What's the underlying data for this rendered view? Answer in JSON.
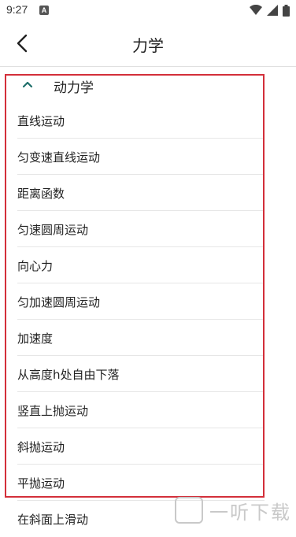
{
  "status_bar": {
    "time": "9:27",
    "notification_icon": "a-letter-icon"
  },
  "app_bar": {
    "title": "力学",
    "back_icon": "chevron-left-icon"
  },
  "group": {
    "label": "动力学",
    "expanded": true
  },
  "items": [
    {
      "label": "直线运动"
    },
    {
      "label": "匀变速直线运动"
    },
    {
      "label": "距离函数"
    },
    {
      "label": "匀速圆周运动"
    },
    {
      "label": "向心力"
    },
    {
      "label": "匀加速圆周运动"
    },
    {
      "label": "加速度"
    },
    {
      "label": "从高度h处自由下落"
    },
    {
      "label": "竖直上抛运动"
    },
    {
      "label": "斜抛运动"
    },
    {
      "label": "平抛运动"
    },
    {
      "label": "在斜面上滑动"
    }
  ],
  "highlight_color": "#d32f3a",
  "watermark": {
    "text": "一听下载"
  }
}
